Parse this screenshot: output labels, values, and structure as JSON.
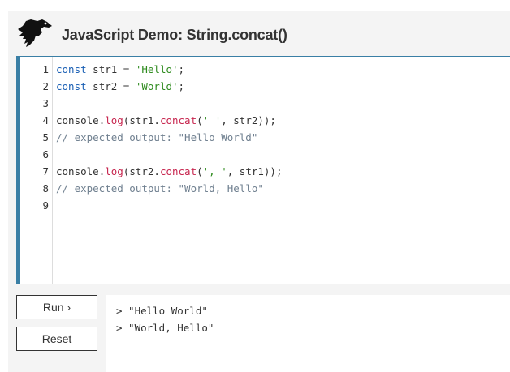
{
  "header": {
    "title": "JavaScript Demo: String.concat()",
    "logo": "dinosaur-logo"
  },
  "editor": {
    "line_numbers": [
      "1",
      "2",
      "3",
      "4",
      "5",
      "6",
      "7",
      "8",
      "9"
    ],
    "lines": [
      [
        {
          "t": "const",
          "c": "kw"
        },
        {
          "t": " str1 = ",
          "c": ""
        },
        {
          "t": "'Hello'",
          "c": "str"
        },
        {
          "t": ";",
          "c": ""
        }
      ],
      [
        {
          "t": "const",
          "c": "kw"
        },
        {
          "t": " str2 = ",
          "c": ""
        },
        {
          "t": "'World'",
          "c": "str"
        },
        {
          "t": ";",
          "c": ""
        }
      ],
      [],
      [
        {
          "t": "console",
          "c": ""
        },
        {
          "t": ".",
          "c": ""
        },
        {
          "t": "log",
          "c": "fn"
        },
        {
          "t": "(str1.",
          "c": ""
        },
        {
          "t": "concat",
          "c": "fn"
        },
        {
          "t": "(",
          "c": ""
        },
        {
          "t": "' '",
          "c": "str"
        },
        {
          "t": ", str2));",
          "c": ""
        }
      ],
      [
        {
          "t": "// expected output: \"Hello World\"",
          "c": "cm"
        }
      ],
      [],
      [
        {
          "t": "console",
          "c": ""
        },
        {
          "t": ".",
          "c": ""
        },
        {
          "t": "log",
          "c": "fn"
        },
        {
          "t": "(str2.",
          "c": ""
        },
        {
          "t": "concat",
          "c": "fn"
        },
        {
          "t": "(",
          "c": ""
        },
        {
          "t": "', '",
          "c": "str"
        },
        {
          "t": ", str1));",
          "c": ""
        }
      ],
      [
        {
          "t": "// expected output: \"World, Hello\"",
          "c": "cm"
        }
      ],
      []
    ]
  },
  "controls": {
    "run_label": "Run ›",
    "reset_label": "Reset"
  },
  "output": {
    "lines": [
      "> \"Hello World\"",
      "> \"World, Hello\""
    ]
  },
  "colors": {
    "accent": "#3a7fa5",
    "keyword": "#1a5fb4",
    "string": "#2e8b1e",
    "function": "#c7254e",
    "comment": "#708090"
  }
}
